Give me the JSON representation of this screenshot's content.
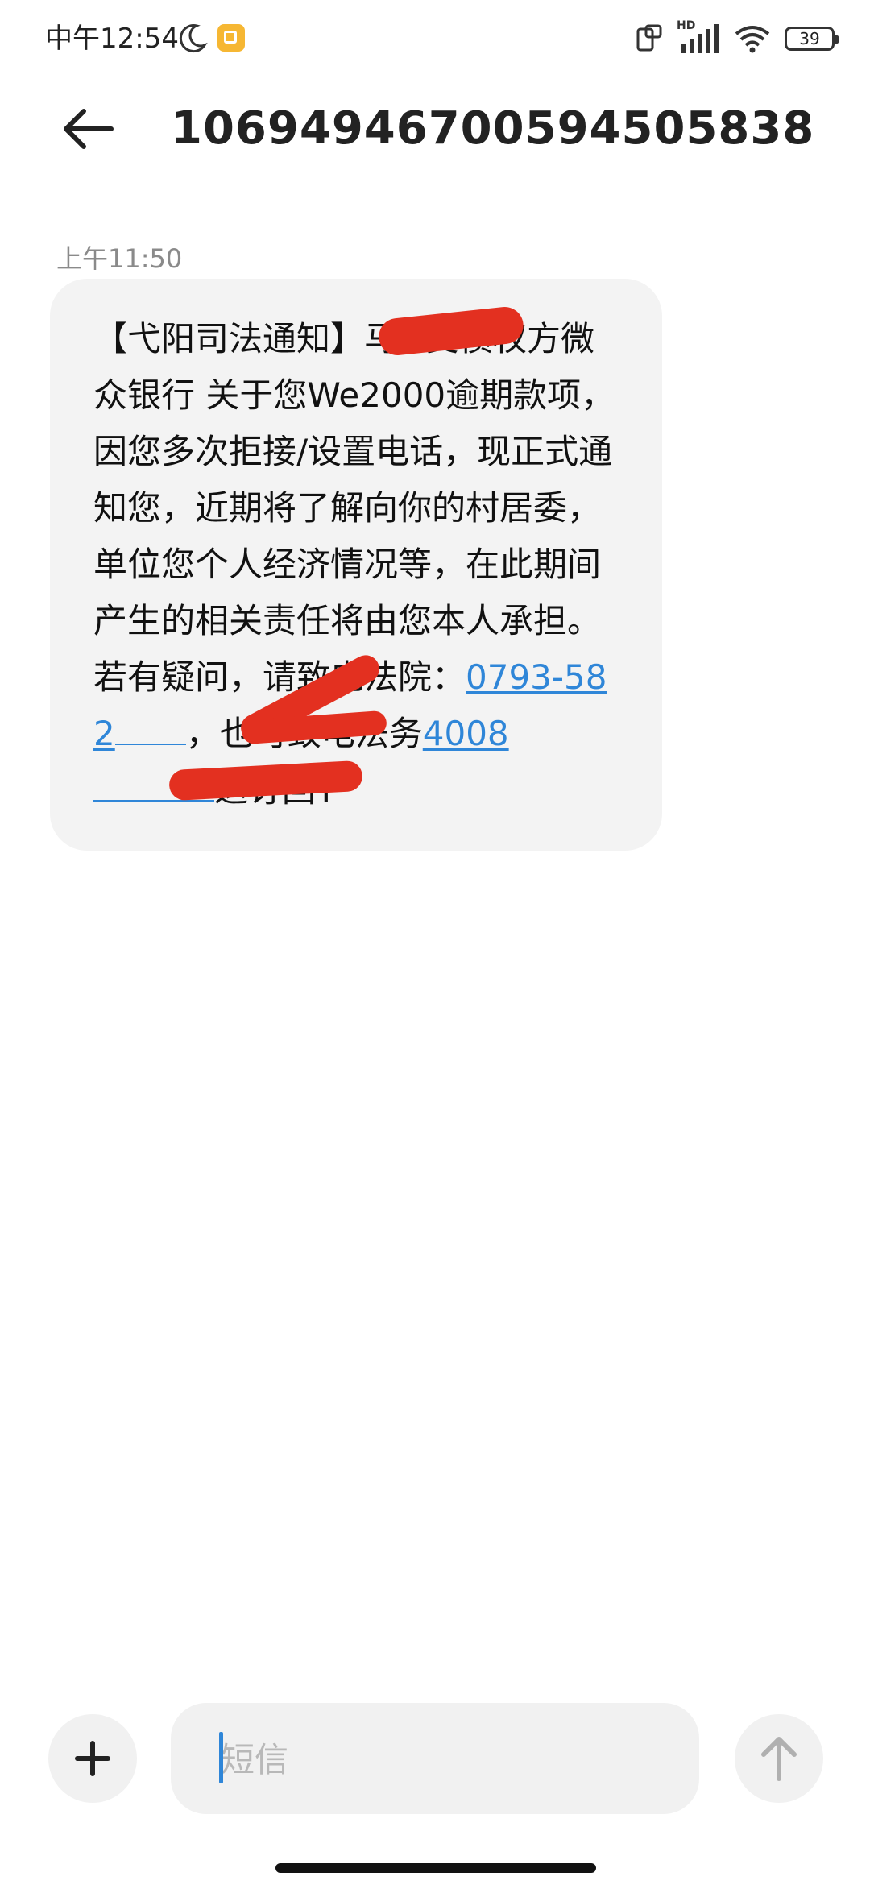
{
  "status_bar": {
    "time": "中午12:54",
    "signal_label": "HD",
    "battery_level": "39",
    "icons": [
      "moon-icon",
      "notes-app-icon",
      "screen-rotate-icon",
      "signal-icon",
      "wifi-icon",
      "battery-icon"
    ]
  },
  "header": {
    "back_icon": "back-arrow-icon",
    "title": "10694946700594505838"
  },
  "message": {
    "timestamp": "上午11:50",
    "segments": {
      "s1": "【弋阳司法通知】马",
      "s2": "受债权方微众银行 关于您We2000逾期款项，因您多次拒接/设置电话，现正式通知您，近期将了解向你的村居委，单位您个人经济情况等，在此期间产生的相关责任将由您本人承担。若有疑问，请致电法院：",
      "link1": "0793-582",
      "s3": "，也可致电法务",
      "link2": "4008",
      "s4": "退订回T"
    }
  },
  "input_bar": {
    "add_icon": "plus-icon",
    "placeholder": "短信",
    "send_icon": "send-arrow-icon"
  },
  "colors": {
    "bubble": "#f3f3f3",
    "link": "#2f86d8",
    "redaction": "#e33020"
  }
}
